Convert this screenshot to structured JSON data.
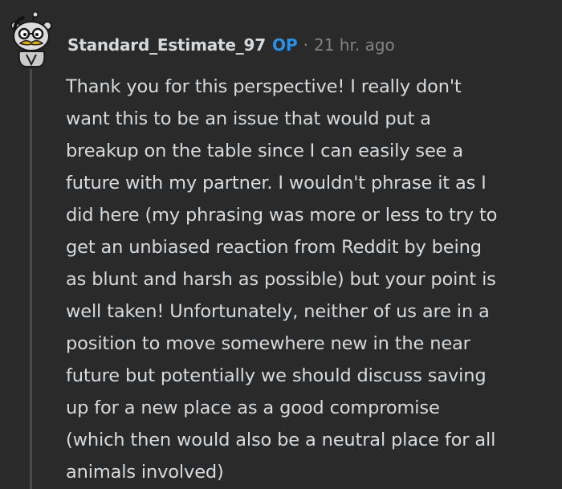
{
  "comment": {
    "author": "Standard_Estimate_97",
    "op_badge": "OP",
    "separator": "·",
    "timestamp": "21 hr. ago",
    "body_lines": [
      "Thank you for this perspective! I really don't",
      "want this to be an issue that would put a",
      "breakup on the table since I can easily see a",
      "future with my partner. I wouldn't phrase it as I",
      "did here (my phrasing was more or less to try to",
      "get an unbiased reaction from Reddit by being",
      "as blunt and harsh as possible) but your point is",
      "well taken! Unfortunately, neither of us are in a",
      "position to move somewhere new in the near",
      "future but potentially we should discuss saving",
      "up for a new place as a good compromise",
      "(which then would also be a neutral place for all",
      "animals involved)"
    ]
  },
  "colors": {
    "background": "#2a2a2b",
    "text": "#d7dadc",
    "muted": "#818384",
    "op_accent": "#2f8fe0",
    "thread_line": "#4a4a4c"
  },
  "icons": {
    "avatar": "snoo-avatar-with-mustache-and-glasses"
  }
}
